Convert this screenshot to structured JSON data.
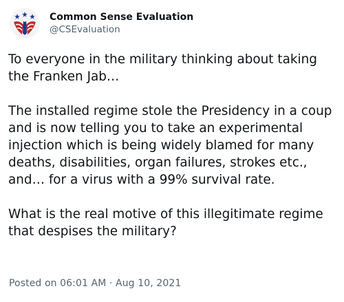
{
  "author": {
    "display_name": "Common Sense Evaluation",
    "handle": "@CSEvaluation",
    "avatar_icon": "eagle-flag-logo-icon"
  },
  "tweet": {
    "paragraphs": [
      "To everyone in the military thinking about taking the Franken Jab…",
      "The installed regime stole the Presidency in a coup and is now telling you to take an experimental injection which is being widely blamed for many deaths, disabilities, organ failures, strokes etc., and… for a virus with a 99% survival rate.",
      "What is the real motive of this illegitimate regime that despises the military?"
    ],
    "timestamp": "Posted on 06:01 AM · Aug 10, 2021"
  },
  "colors": {
    "text": "#0f1419",
    "secondary": "#536471",
    "logo_red": "#c62828",
    "logo_blue": "#1a3b8f"
  }
}
